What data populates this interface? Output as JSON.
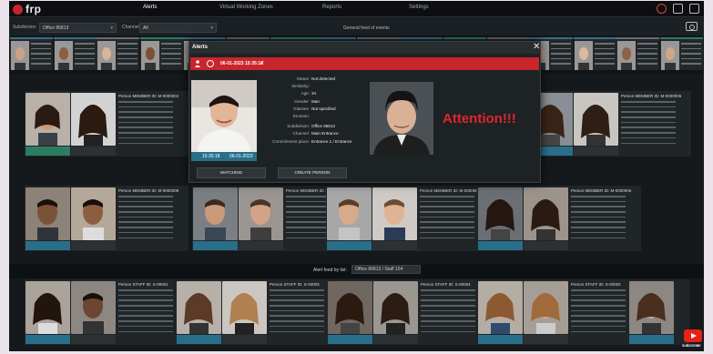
{
  "app": {
    "logo_text": "frp"
  },
  "nav": {
    "tabs": [
      "Alerts",
      "Virtual Working Zones",
      "Reports",
      "Settings"
    ]
  },
  "filters": {
    "subdivision_label": "Subdivision",
    "subdivision_value": "Office 86813",
    "channel_label": "Channel",
    "channel_value": "All",
    "feed_title": "General feed of events"
  },
  "modal": {
    "title": "Alerts",
    "alert_datetime": "06-01-2023 15:35:18",
    "photo_time": "15:35:18",
    "photo_date": "06-01-2023",
    "rows": [
      {
        "k": "Status:",
        "v": "Not detected"
      },
      {
        "k": "Similarity:",
        "v": ""
      },
      {
        "k": "Age:",
        "v": "34"
      },
      {
        "k": "Gender:",
        "v": "Man"
      },
      {
        "k": "Glasses:",
        "v": "Not specified"
      },
      {
        "k": "Emotion:",
        "v": ""
      },
      {
        "k": "Subdivision:",
        "v": "Office 86813"
      },
      {
        "k": "Channel:",
        "v": "Main Entrance"
      },
      {
        "k": "Control/event place:",
        "v": "Entrance 1 / Entrance"
      }
    ],
    "attention_text": "Attention!!!",
    "watching_label": "WATCHING",
    "create_person_label": "CREATE PERSON"
  },
  "rows": {
    "row1": [
      {
        "header": "Person MEMBER ID: M-0000004"
      },
      {
        "header": "Person MEMBER ID: M-0000006"
      }
    ],
    "row2": [
      {
        "header": "Person MEMBER ID: M-0000009"
      },
      {
        "header": "Person MEMBER ID: M-0000007"
      },
      {
        "header": "Person MEMBER ID: M-0000008"
      },
      {
        "header": "Person MEMBER ID: M-0000006"
      }
    ],
    "row3": [
      {
        "header": "Person STAFF ID: S-00001"
      },
      {
        "header": "Person STAFF ID: S-00003"
      },
      {
        "header": "Person STAFF ID: S-00004"
      },
      {
        "header": "Person STAFF ID: S-00002"
      }
    ]
  },
  "feed_filter": {
    "label": "Alert feed by list:",
    "value": "Office 86813 / Staff 154"
  },
  "youtube": {
    "label": "SUBSCRIBE"
  },
  "colors": {
    "alert_red": "#c9252c",
    "timestamp_blue": "#2a6f8a",
    "accent_green": "#2b7d62"
  }
}
